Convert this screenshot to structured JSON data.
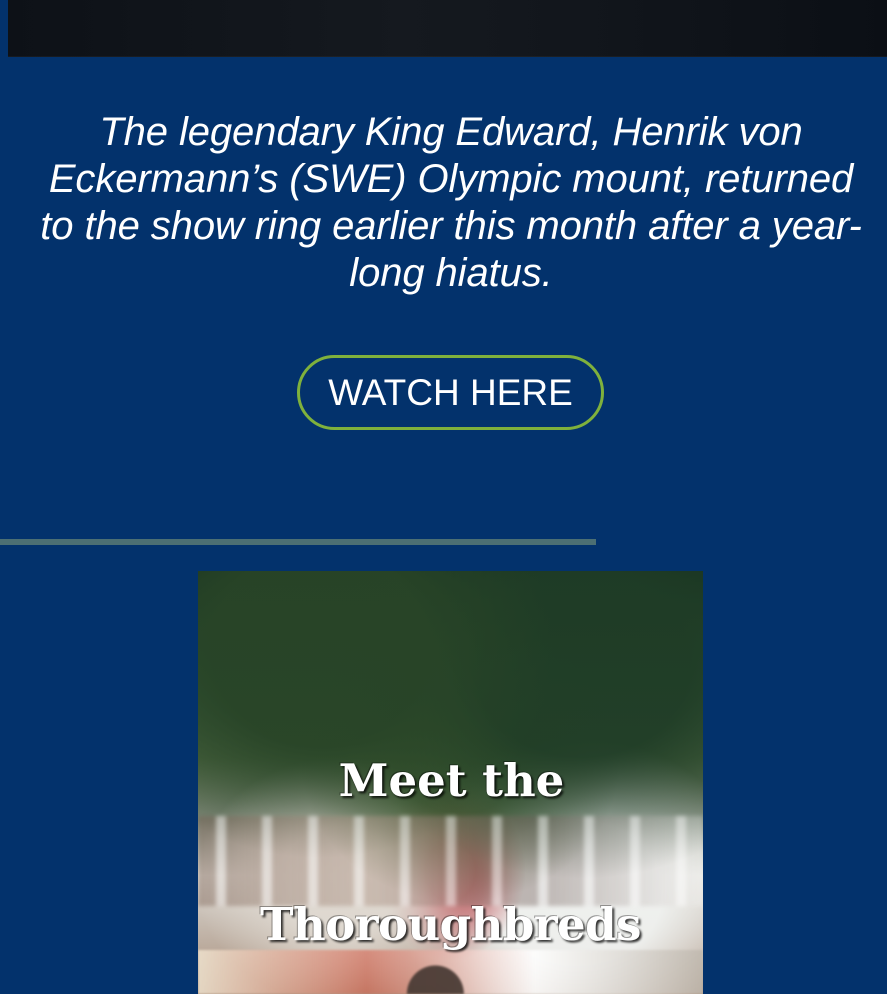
{
  "article": {
    "description": "The legendary King Edward, Henrik von Eckermann’s (SWE) Olympic mount, returned to the show ring earlier this month after a year-long hiatus.",
    "button_label": "WATCH HERE"
  },
  "feature": {
    "title_line_1": "Meet the",
    "title_line_2": "Thoroughbreds"
  },
  "colors": {
    "page_background": "#03326c",
    "button_border": "#7fb13c",
    "divider": "#4c6f73",
    "text": "#ffffff"
  }
}
